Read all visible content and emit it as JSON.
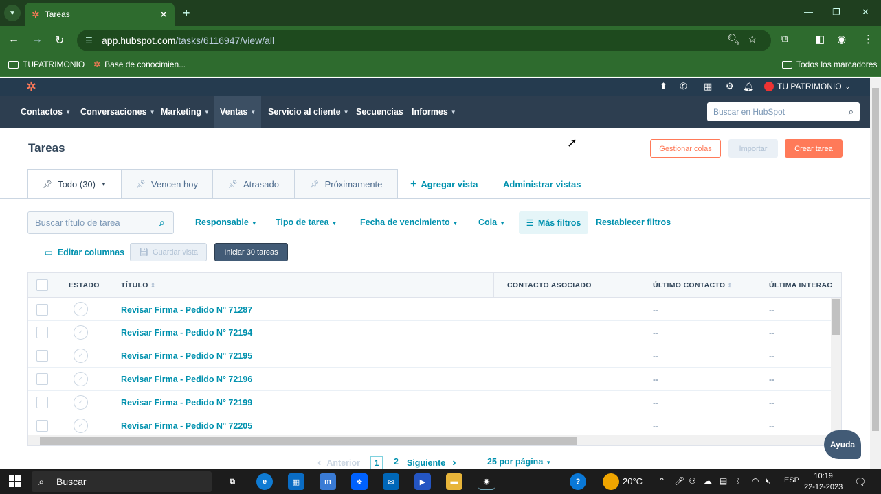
{
  "browser": {
    "tab_title": "Tareas",
    "url_host": "app.hubspot.com",
    "url_path": "/tasks/6116947/view/all",
    "bookmarks": [
      "TUPATRIMONIO",
      "Base de conocimien..."
    ],
    "all_bookmarks": "Todos los marcadores"
  },
  "hubspot": {
    "account_name": "TU PATRIMONIO",
    "nav": [
      "Contactos",
      "Conversaciones",
      "Marketing",
      "Ventas",
      "Servicio al cliente",
      "Secuencias",
      "Informes"
    ],
    "search_placeholder": "Buscar en HubSpot"
  },
  "page": {
    "title": "Tareas",
    "btn_manage_queues": "Gestionar colas",
    "btn_import": "Importar",
    "btn_create": "Crear tarea",
    "views": [
      "Todo (30)",
      "Vencen hoy",
      "Atrasado",
      "Próximamente"
    ],
    "add_view": "Agregar vista",
    "manage_views": "Administrar vistas",
    "search_placeholder": "Buscar título de tarea",
    "filters": [
      "Responsable",
      "Tipo de tarea",
      "Fecha de vencimiento",
      "Cola"
    ],
    "more_filters": "Más filtros",
    "reset_filters": "Restablecer filtros",
    "edit_columns": "Editar columnas",
    "save_view": "Guardar vista",
    "start_tasks": "Iniciar 30 tareas"
  },
  "table": {
    "headers": [
      "ESTADO",
      "TÍTULO",
      "CONTACTO ASOCIADO",
      "ÚLTIMO CONTACTO",
      "ÚLTIMA INTERAC"
    ],
    "rows": [
      {
        "title": "Revisar Firma - Pedido N° 71287",
        "last_contact": "--",
        "last_interaction": "--"
      },
      {
        "title": "Revisar Firma - Pedido N° 72194",
        "last_contact": "--",
        "last_interaction": "--"
      },
      {
        "title": "Revisar Firma - Pedido N° 72195",
        "last_contact": "--",
        "last_interaction": "--"
      },
      {
        "title": "Revisar Firma - Pedido N° 72196",
        "last_contact": "--",
        "last_interaction": "--"
      },
      {
        "title": "Revisar Firma - Pedido N° 72199",
        "last_contact": "--",
        "last_interaction": "--"
      },
      {
        "title": "Revisar Firma - Pedido N° 72205",
        "last_contact": "--",
        "last_interaction": "--"
      }
    ]
  },
  "pagination": {
    "prev": "Anterior",
    "page1": "1",
    "page2": "2",
    "next": "Siguiente",
    "per_page": "25 por página"
  },
  "help": "Ayuda",
  "taskbar": {
    "search": "Buscar",
    "weather": "20°C",
    "lang": "ESP",
    "time": "10:19",
    "date": "22-12-2023"
  },
  "colors": {
    "hubspot_orange": "#ff7a59",
    "hubspot_nav": "#2d3e50",
    "link_teal": "#0091ae",
    "browser_green": "#2e6b2e"
  }
}
